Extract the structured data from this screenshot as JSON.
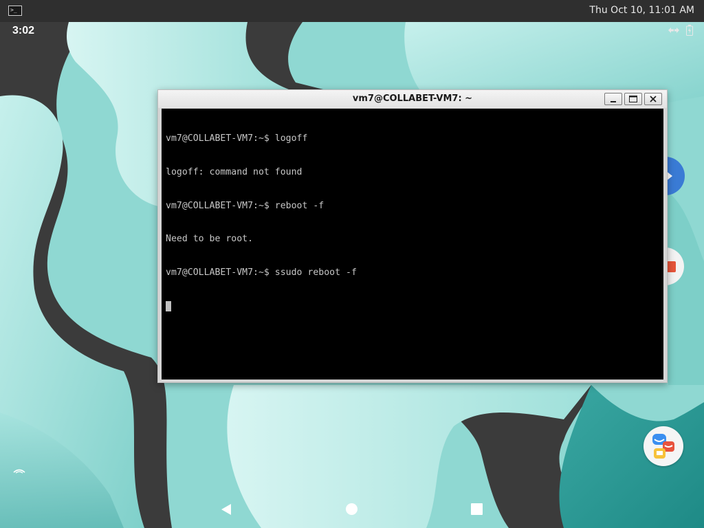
{
  "host_bar": {
    "terminal_icon_text": ">_",
    "clock": "Thu Oct 10, 11:01 AM"
  },
  "android_status": {
    "time": "3:02",
    "icons": [
      "data-transfer-icon",
      "battery-icon"
    ]
  },
  "terminal_window": {
    "title": "vm7@COLLABET-VM7: ~",
    "buttons": [
      "minimize",
      "maximize",
      "close"
    ],
    "lines": [
      "vm7@COLLABET-VM7:~$ logoff",
      "logoff: command not found",
      "vm7@COLLABET-VM7:~$ reboot -f",
      "Need to be root.",
      "vm7@COLLABET-VM7:~$ ssudo reboot -f"
    ]
  },
  "navigation_bar": {
    "buttons": [
      "back",
      "home",
      "recents"
    ]
  },
  "colors": {
    "host_bar_bg": "#2f2f2f",
    "terminal_bg": "#000000",
    "terminal_text": "#c6c6c6",
    "wallpaper_teal": "#8fd8d2",
    "wallpaper_dark": "#3a3a3a"
  }
}
